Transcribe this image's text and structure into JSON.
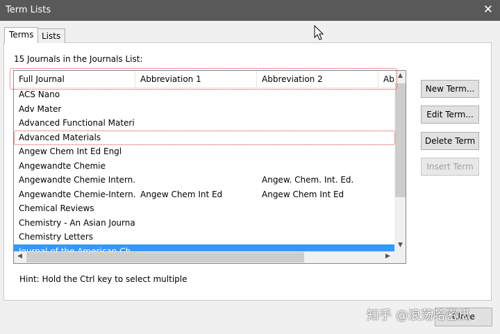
{
  "window": {
    "title": "Term Lists",
    "close_glyph": "✕"
  },
  "tabs": [
    {
      "label": "Terms"
    },
    {
      "label": "Lists"
    }
  ],
  "list_label": "15 Journals in the Journals List:",
  "columns": [
    "Full Journal",
    "Abbreviation 1",
    "Abbreviation 2",
    "Ab"
  ],
  "rows": [
    {
      "full": "ACS Nano",
      "abbr1": "",
      "abbr2": ""
    },
    {
      "full": "Adv Mater",
      "abbr1": "",
      "abbr2": ""
    },
    {
      "full": "Advanced Functional Materi...",
      "abbr1": "",
      "abbr2": ""
    },
    {
      "full": "Advanced Materials",
      "abbr1": "",
      "abbr2": ""
    },
    {
      "full": "Angew Chem Int Ed Engl",
      "abbr1": "",
      "abbr2": ""
    },
    {
      "full": "Angewandte Chemie",
      "abbr1": "",
      "abbr2": ""
    },
    {
      "full": "Angewandte Chemie Intern...",
      "abbr1": "",
      "abbr2": "Angew. Chem. Int. Ed."
    },
    {
      "full": "Angewandte Chemie-Intern...",
      "abbr1": "Angew Chem Int Ed",
      "abbr2": "Angew Chem Int Ed"
    },
    {
      "full": "Chemical Reviews",
      "abbr1": "",
      "abbr2": ""
    },
    {
      "full": "Chemistry - An Asian Journal",
      "abbr1": "",
      "abbr2": ""
    },
    {
      "full": "Chemistry Letters",
      "abbr1": "",
      "abbr2": ""
    },
    {
      "full": "Journal of the American Ch...",
      "abbr1": "",
      "abbr2": ""
    }
  ],
  "selected_row": "Journal of the American Ch...",
  "buttons": {
    "new_term": "New Term...",
    "edit_term": "Edit Term...",
    "delete_term": "Delete Term",
    "insert_term": "Insert Term",
    "close": "Close"
  },
  "hint": "Hint: Hold the Ctrl key to select multiple",
  "watermark": "知乎 @浪荡哈密瓜",
  "colors": {
    "titlebar": "#595959",
    "selection": "#3399ff",
    "highlight_box": "#dd3333"
  },
  "icons": [
    "close-icon",
    "mouse-cursor-icon",
    "scroll-up-arrow-icon",
    "scroll-down-arrow-icon",
    "scroll-left-arrow-icon",
    "scroll-right-arrow-icon"
  ]
}
